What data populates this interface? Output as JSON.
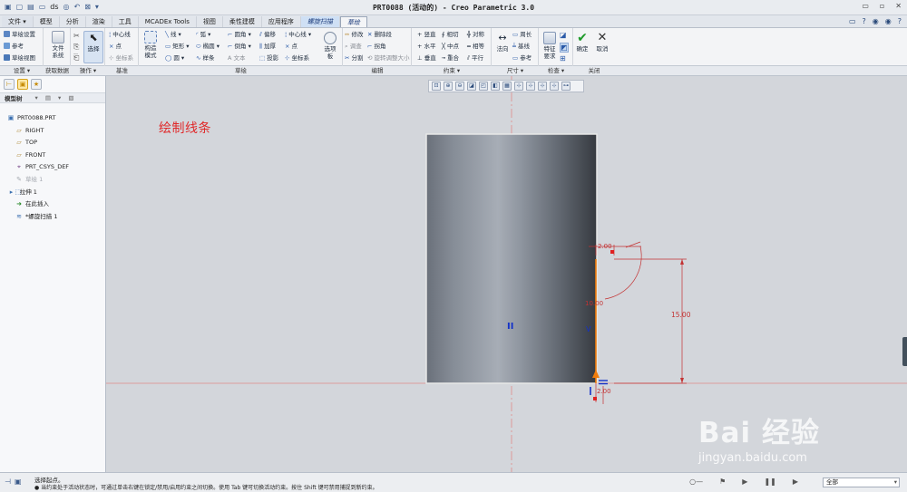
{
  "window": {
    "title": "PRT0088 (活动的) - Creo Parametric 3.0",
    "quick_access": [
      "new",
      "open",
      "save",
      "regenerate",
      "undo",
      "redo",
      "window",
      "more"
    ],
    "quick_access_icons": [
      "▣",
      "▢",
      "▤",
      "▭",
      "◎",
      "↶",
      "⊠",
      "▾"
    ],
    "quick_access_label": "ds",
    "win_buttons": [
      "▭",
      "▫",
      "✕"
    ],
    "right_icons": [
      "▭",
      "?",
      "◉",
      "◉",
      "?"
    ]
  },
  "menu_tabs": [
    {
      "label": "文件 ▾",
      "kind": "file"
    },
    {
      "label": "模型",
      "kind": "normal"
    },
    {
      "label": "分析",
      "kind": "normal"
    },
    {
      "label": "渲染",
      "kind": "normal"
    },
    {
      "label": "工具",
      "kind": "normal"
    },
    {
      "label": "MCADEx Tools",
      "kind": "normal"
    },
    {
      "label": "视图",
      "kind": "normal"
    },
    {
      "label": "柔性建模",
      "kind": "normal"
    },
    {
      "label": "应用程序",
      "kind": "normal"
    },
    {
      "label": "螺旋扫描",
      "kind": "context"
    },
    {
      "label": "草绘",
      "kind": "active"
    }
  ],
  "ribbon": {
    "settings": {
      "items": [
        "草绘设置",
        "参考",
        "草绘视图"
      ]
    },
    "get_data": {
      "file_system": "文件\n系统"
    },
    "operations": {
      "select": "选择"
    },
    "datum": {
      "items": [
        "中心线",
        "点",
        "坐标系"
      ]
    },
    "sketch": {
      "construction_mode": "构造\n模式",
      "col1": [
        "线",
        "矩形",
        "圆"
      ],
      "col2": [
        "弧",
        "椭圆",
        "样条"
      ],
      "col3": [
        "圆角",
        "倒角",
        "文本"
      ],
      "col4": [
        "偏移",
        "加厚",
        "投影"
      ],
      "col5": [
        "中心线",
        "点",
        "坐标系"
      ],
      "palette": "选项\n板"
    },
    "edit": {
      "col1": [
        "修改",
        "删除段"
      ],
      "col2": [
        "调查",
        "拐角"
      ],
      "col3": [
        "分割",
        "旋转调整大小"
      ]
    },
    "constrain": {
      "col1": [
        "竖直",
        "水平",
        "垂直"
      ],
      "col2": [
        "相切",
        "中点",
        "重合"
      ],
      "col3": [
        "对称",
        "相等",
        "平行"
      ]
    },
    "dimension": {
      "normal": "法向",
      "items": [
        "周长",
        "基线",
        "参考"
      ]
    },
    "inspect": {
      "feature_req": "特征\n要求"
    },
    "close": {
      "ok": "确定",
      "cancel": "取消"
    }
  },
  "group_labels": [
    "设置 ▾",
    "获取数据",
    "操作 ▾",
    "基准",
    "草绘",
    "编辑",
    "约束 ▾",
    "尺寸 ▾",
    "检查 ▾",
    "关闭"
  ],
  "left_panel": {
    "header": "模型树",
    "header_icons": "▾ ▤ ▾ ▧",
    "tree": [
      {
        "label": "PRT0088.PRT",
        "icon": "▣",
        "indent": 0,
        "dim": false,
        "color": "#3a6fb0"
      },
      {
        "label": "RIGHT",
        "icon": "▱",
        "indent": 1,
        "dim": false,
        "color": "#b08a3a"
      },
      {
        "label": "TOP",
        "icon": "▱",
        "indent": 1,
        "dim": false,
        "color": "#b08a3a"
      },
      {
        "label": "FRONT",
        "icon": "▱",
        "indent": 1,
        "dim": false,
        "color": "#b08a3a"
      },
      {
        "label": "PRT_CSYS_DEF",
        "icon": "⌖",
        "indent": 1,
        "dim": false,
        "color": "#7a4a8a"
      },
      {
        "label": "草绘 1",
        "icon": "✎",
        "indent": 1,
        "dim": true,
        "color": "#a5a9b0"
      },
      {
        "label": "拉伸 1",
        "icon": "▸ ⬚",
        "indent": 0.3,
        "dim": false,
        "color": "#3a6fb0"
      },
      {
        "label": "在此插入",
        "icon": "➜",
        "indent": 1,
        "dim": false,
        "color": "#2a8a2a"
      },
      {
        "label": "*螺旋扫描 1",
        "icon": "≋",
        "indent": 1,
        "dim": false,
        "color": "#3a6fb0"
      }
    ]
  },
  "graphics_toolbar": {
    "icons": [
      "⊡",
      "⊕",
      "⊖",
      "◪",
      "◰",
      "◧",
      "▦",
      "⊹",
      "⊹",
      "⊹",
      "⊹",
      "⊶"
    ]
  },
  "caption": "绘制线条",
  "sketch": {
    "dimensions": {
      "top_width": "2.00",
      "height": "15.00",
      "bottom_width": "2.00",
      "center": "10.00"
    },
    "symbols": {
      "parallel_mark": "II",
      "vertical_mark": "V"
    }
  },
  "status": {
    "line1": "选择起点。",
    "line2": "● 当约束处于活动状态时，可通过单击右键在锁定/禁用/启用约束之间切换。使用 Tab 键可切换活动约束。按住 Shift 键可禁用捕捉到新约束。",
    "filter": "全部",
    "left_icons": [
      "⊣",
      "▣"
    ],
    "right_icons": [
      "○—",
      "⚑",
      "▶",
      "❚❚",
      "▶"
    ]
  },
  "watermark": {
    "main": "Bai 经验",
    "sub": "jingyan.baidu.com"
  },
  "colors": {
    "accent_red": "#e0292a",
    "sketch_orange": "#f07d0c",
    "dim_red": "#c33232",
    "constraint_blue": "#1432c8"
  }
}
